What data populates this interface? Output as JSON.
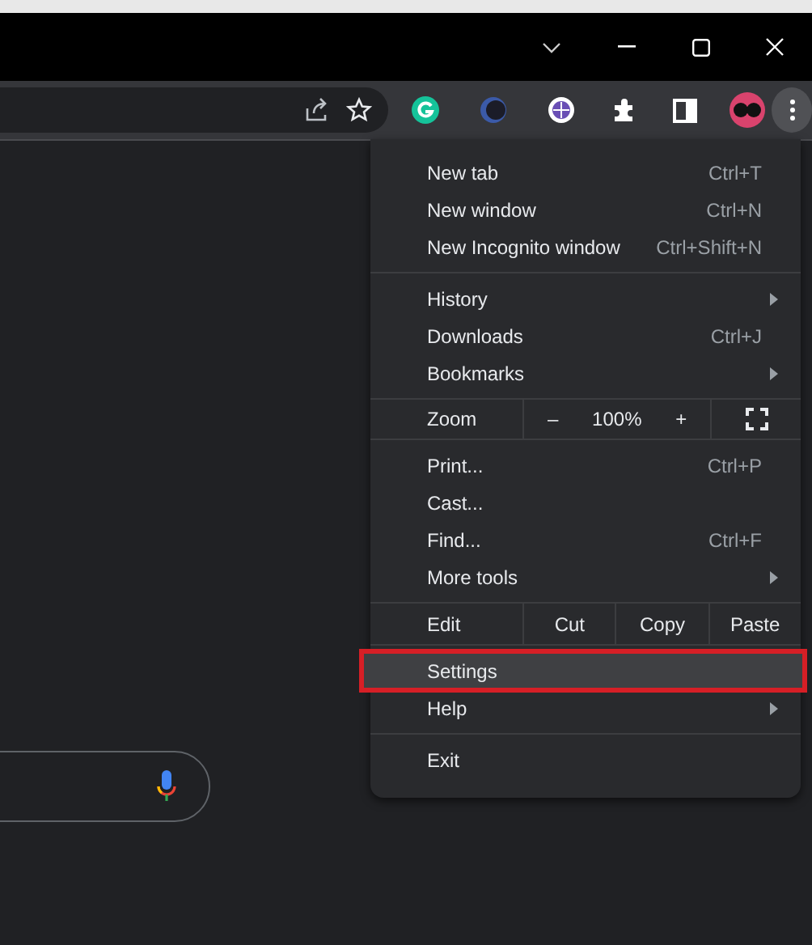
{
  "menu": {
    "sections": [
      {
        "rows": [
          {
            "kind": "item",
            "label": "New tab",
            "shortcut": "Ctrl+T",
            "submenu": false,
            "selected": false,
            "outlined": false
          },
          {
            "kind": "item",
            "label": "New window",
            "shortcut": "Ctrl+N",
            "submenu": false,
            "selected": false,
            "outlined": false
          },
          {
            "kind": "item",
            "label": "New Incognito window",
            "shortcut": "Ctrl+Shift+N",
            "submenu": false,
            "selected": false,
            "outlined": false
          }
        ]
      },
      {
        "rows": [
          {
            "kind": "item",
            "label": "History",
            "submenu": true,
            "selected": false,
            "outlined": false
          },
          {
            "kind": "item",
            "label": "Downloads",
            "shortcut": "Ctrl+J",
            "submenu": false,
            "selected": false,
            "outlined": false
          },
          {
            "kind": "item",
            "label": "Bookmarks",
            "submenu": true,
            "selected": false,
            "outlined": false
          }
        ]
      },
      {
        "rows": [
          {
            "kind": "zoom",
            "label": "Zoom",
            "minus": "–",
            "value": "100%",
            "plus": "+"
          }
        ]
      },
      {
        "rows": [
          {
            "kind": "item",
            "label": "Print...",
            "shortcut": "Ctrl+P",
            "submenu": false,
            "selected": false,
            "outlined": false
          },
          {
            "kind": "item",
            "label": "Cast...",
            "submenu": false,
            "selected": false,
            "outlined": false
          },
          {
            "kind": "item",
            "label": "Find...",
            "shortcut": "Ctrl+F",
            "submenu": false,
            "selected": false,
            "outlined": false
          },
          {
            "kind": "item",
            "label": "More tools",
            "submenu": true,
            "selected": false,
            "outlined": false
          }
        ]
      },
      {
        "rows": [
          {
            "kind": "edit",
            "label": "Edit",
            "actions": [
              "Cut",
              "Copy",
              "Paste"
            ]
          }
        ]
      },
      {
        "rows": [
          {
            "kind": "item",
            "label": "Settings",
            "submenu": false,
            "selected": true,
            "outlined": true
          },
          {
            "kind": "item",
            "label": "Help",
            "submenu": true,
            "selected": false,
            "outlined": false
          }
        ]
      },
      {
        "rows": [
          {
            "kind": "item",
            "label": "Exit",
            "submenu": false,
            "selected": false,
            "outlined": false
          }
        ]
      }
    ]
  }
}
